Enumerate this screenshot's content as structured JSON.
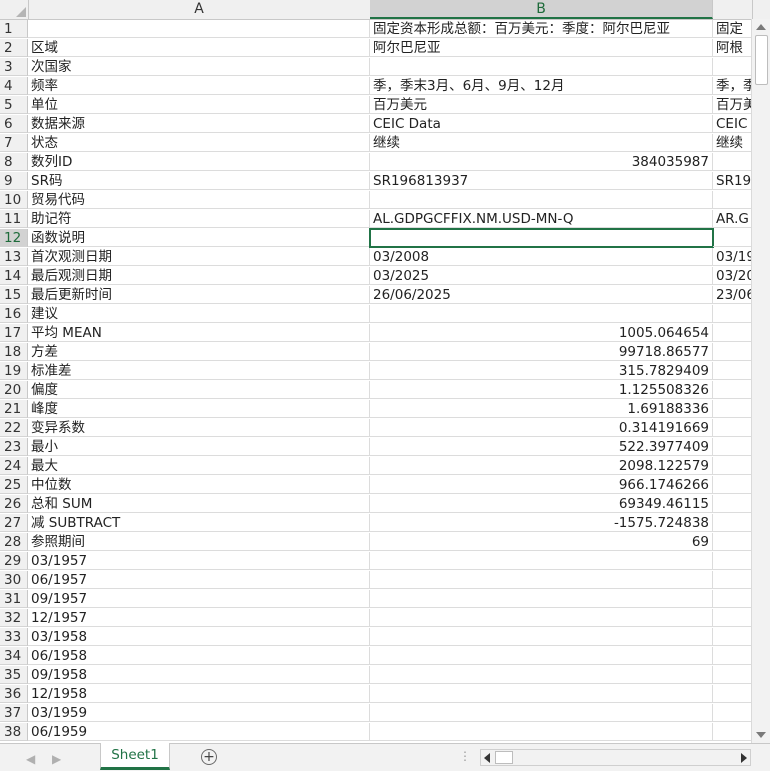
{
  "columns": {
    "A": "A",
    "B": "B"
  },
  "sheet_tab": "Sheet1",
  "rows": [
    {
      "n": "1",
      "a": "",
      "b": "固定资本形成总额：百万美元：季度：阿尔巴尼亚",
      "b_num": false,
      "c": "固定"
    },
    {
      "n": "2",
      "a": "区域",
      "b": "阿尔巴尼亚",
      "b_num": false,
      "c": "阿根"
    },
    {
      "n": "3",
      "a": "次国家",
      "b": "",
      "b_num": false,
      "c": ""
    },
    {
      "n": "4",
      "a": "频率",
      "b": "季，季末3月、6月、9月、12月",
      "b_num": false,
      "c": "季，季"
    },
    {
      "n": "5",
      "a": "单位",
      "b": "百万美元",
      "b_num": false,
      "c": "百万美"
    },
    {
      "n": "6",
      "a": "数据来源",
      "b": "CEIC Data",
      "b_num": false,
      "c": "CEIC"
    },
    {
      "n": "7",
      "a": "状态",
      "b": "继续",
      "b_num": false,
      "c": "继续"
    },
    {
      "n": "8",
      "a": "数列ID",
      "b": "384035987",
      "b_num": true,
      "c": ""
    },
    {
      "n": "9",
      "a": "SR码",
      "b": "SR196813937",
      "b_num": false,
      "c": "SR19"
    },
    {
      "n": "10",
      "a": "贸易代码",
      "b": "",
      "b_num": false,
      "c": ""
    },
    {
      "n": "11",
      "a": "助记符",
      "b": "AL.GDPGCFFIX.NM.USD-MN-Q",
      "b_num": false,
      "c": "AR.G"
    },
    {
      "n": "12",
      "a": "函数说明",
      "b": "",
      "b_num": false,
      "c": ""
    },
    {
      "n": "13",
      "a": "首次观测日期",
      "b": "03/2008",
      "b_num": false,
      "c": "03/19"
    },
    {
      "n": "14",
      "a": "最后观测日期",
      "b": "03/2025",
      "b_num": false,
      "c": "03/20"
    },
    {
      "n": "15",
      "a": "最后更新时间",
      "b": "26/06/2025",
      "b_num": false,
      "c": "23/06"
    },
    {
      "n": "16",
      "a": "建议",
      "b": "",
      "b_num": false,
      "c": ""
    },
    {
      "n": "17",
      "a": "平均 MEAN",
      "b": "1005.064654",
      "b_num": true,
      "c": ""
    },
    {
      "n": "18",
      "a": "方差",
      "b": "99718.86577",
      "b_num": true,
      "c": ""
    },
    {
      "n": "19",
      "a": "标准差",
      "b": "315.7829409",
      "b_num": true,
      "c": ""
    },
    {
      "n": "20",
      "a": "偏度",
      "b": "1.125508326",
      "b_num": true,
      "c": ""
    },
    {
      "n": "21",
      "a": "峰度",
      "b": "1.69188336",
      "b_num": true,
      "c": ""
    },
    {
      "n": "22",
      "a": "变异系数",
      "b": "0.314191669",
      "b_num": true,
      "c": ""
    },
    {
      "n": "23",
      "a": "最小",
      "b": "522.3977409",
      "b_num": true,
      "c": ""
    },
    {
      "n": "24",
      "a": "最大",
      "b": "2098.122579",
      "b_num": true,
      "c": ""
    },
    {
      "n": "25",
      "a": "中位数",
      "b": "966.1746266",
      "b_num": true,
      "c": ""
    },
    {
      "n": "26",
      "a": "总和 SUM",
      "b": "69349.46115",
      "b_num": true,
      "c": ""
    },
    {
      "n": "27",
      "a": "减 SUBTRACT",
      "b": "-1575.724838",
      "b_num": true,
      "c": ""
    },
    {
      "n": "28",
      "a": "参照期间",
      "b": "69",
      "b_num": true,
      "c": ""
    },
    {
      "n": "29",
      "a": "03/1957",
      "b": "",
      "b_num": false,
      "c": ""
    },
    {
      "n": "30",
      "a": "06/1957",
      "b": "",
      "b_num": false,
      "c": ""
    },
    {
      "n": "31",
      "a": "09/1957",
      "b": "",
      "b_num": false,
      "c": ""
    },
    {
      "n": "32",
      "a": "12/1957",
      "b": "",
      "b_num": false,
      "c": ""
    },
    {
      "n": "33",
      "a": "03/1958",
      "b": "",
      "b_num": false,
      "c": ""
    },
    {
      "n": "34",
      "a": "06/1958",
      "b": "",
      "b_num": false,
      "c": ""
    },
    {
      "n": "35",
      "a": "09/1958",
      "b": "",
      "b_num": false,
      "c": ""
    },
    {
      "n": "36",
      "a": "12/1958",
      "b": "",
      "b_num": false,
      "c": ""
    },
    {
      "n": "37",
      "a": "03/1959",
      "b": "",
      "b_num": false,
      "c": ""
    },
    {
      "n": "38",
      "a": "06/1959",
      "b": "",
      "b_num": false,
      "c": ""
    }
  ],
  "selected_row": "12",
  "colors": {
    "accent": "#217346",
    "header_bg": "#f0f0f0",
    "grid": "#dcdcdc"
  }
}
